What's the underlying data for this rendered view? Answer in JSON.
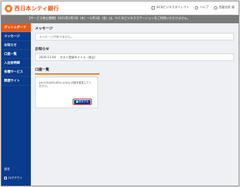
{
  "header": {
    "bank_name": "西日本シティ銀行",
    "links": [
      {
        "label": "NCBビジネスダイレクト",
        "icon": "window-icon"
      },
      {
        "label": "ヘルプ",
        "icon": "help-icon"
      },
      {
        "label": "西銀太郎 様",
        "icon": "user-icon"
      }
    ]
  },
  "notice_bar": "【サービス休止期間】2021年1月1日（木）～1月3日（金）は、ＮＣＢビジネスステーションをご利用いただけません。",
  "sidebar": {
    "items": [
      {
        "label": "ダッシュボード",
        "active": true
      },
      {
        "label": "メッセージ",
        "active": false
      },
      {
        "label": "お知らせ",
        "active": false
      },
      {
        "label": "口座一覧",
        "active": false
      },
      {
        "label": "入出金明細",
        "active": false
      },
      {
        "label": "各種サービス",
        "active": false
      },
      {
        "label": "関連サイト",
        "active": false
      }
    ],
    "bottom": {
      "settings": "設定",
      "logout": "ログアウト"
    }
  },
  "main": {
    "message": {
      "title": "メッセージ",
      "body": "メッセージがありません。"
    },
    "notice": {
      "title": "お知らせ",
      "date": "2020-11-04",
      "body": "テスト登録タイトル（本日）"
    },
    "accounts": {
      "title": "口座一覧",
      "message": "[ACCOUNTS-MSG-1000] 口座を設定してください。",
      "button": "設定する"
    }
  },
  "colors": {
    "accent": "#e8591a",
    "sidebar": "#0a3b8c",
    "button_highlight": "#d2202a"
  }
}
